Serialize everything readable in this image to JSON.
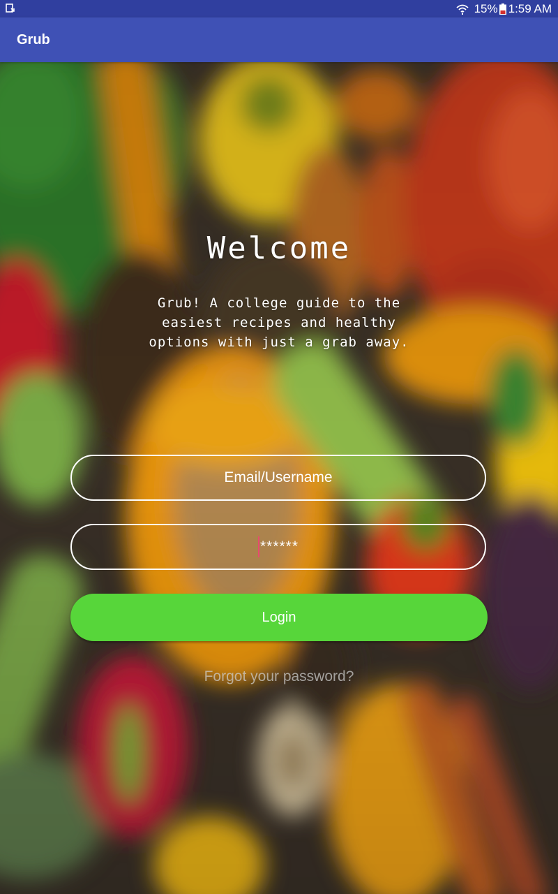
{
  "status_bar": {
    "battery": "15%",
    "time": "1:59 AM",
    "icons": [
      "notification-icon",
      "wifi-icon",
      "battery-icon"
    ]
  },
  "app_bar": {
    "title": "Grub"
  },
  "welcome": {
    "title": "Welcome",
    "tagline": "Grub! A college guide to the\neasiest recipes and healthy\noptions with just a grab away."
  },
  "login_form": {
    "email_placeholder": "Email/Username",
    "password_value": "******",
    "login_label": "Login",
    "forgot_label": "Forgot your password?"
  },
  "colors": {
    "status_bar": "#303F9F",
    "app_bar": "#3F51B5",
    "login_button": "#57d63a",
    "cursor": "#e84a6f"
  }
}
